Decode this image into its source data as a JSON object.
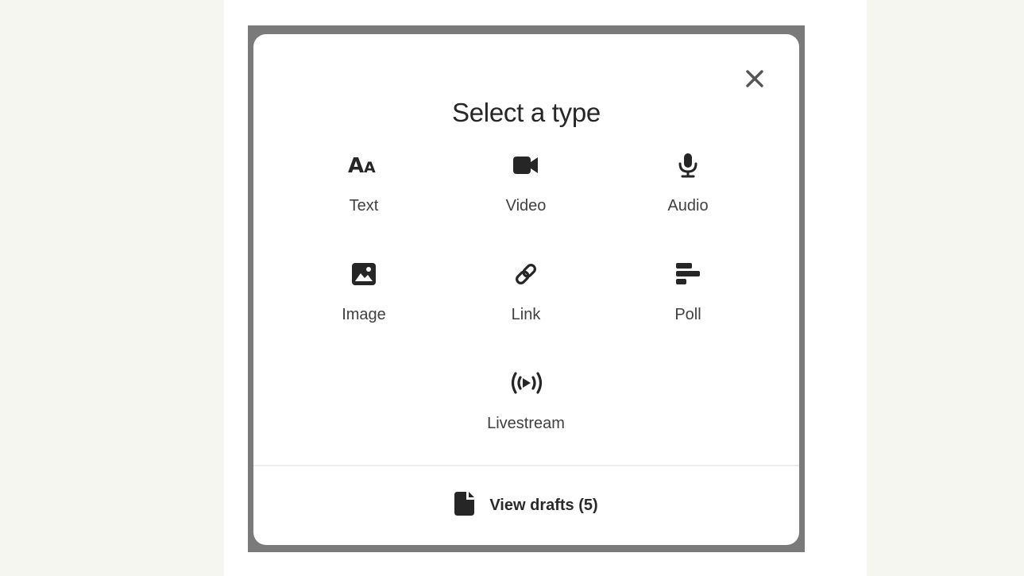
{
  "modal": {
    "title": "Select a type",
    "close_icon": "close-icon",
    "options": [
      {
        "label": "Text",
        "icon": "text-format-icon"
      },
      {
        "label": "Video",
        "icon": "video-camera-icon"
      },
      {
        "label": "Audio",
        "icon": "microphone-icon"
      },
      {
        "label": "Image",
        "icon": "image-icon"
      },
      {
        "label": "Link",
        "icon": "link-icon"
      },
      {
        "label": "Poll",
        "icon": "poll-icon"
      },
      {
        "label": "Livestream",
        "icon": "livestream-icon"
      }
    ],
    "drafts": {
      "label": "View drafts (5)",
      "icon": "document-icon"
    }
  },
  "colors": {
    "page_background": "#f5f6ef",
    "overlay": "#7a7a7a",
    "icon": "#262626",
    "text": "#404040"
  }
}
